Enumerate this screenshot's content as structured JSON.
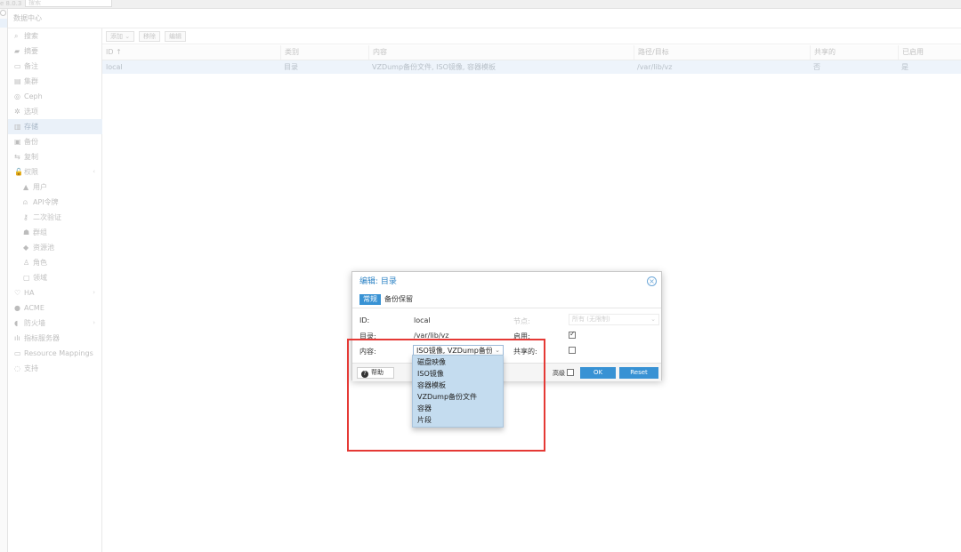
{
  "topbar": {
    "version": "e 8.0.3",
    "search_placeholder": "搜索"
  },
  "header": {
    "title": "数据中心"
  },
  "sidebar": {
    "items": [
      {
        "label": "搜索",
        "icon": "search-icon",
        "glyph": "⌕"
      },
      {
        "label": "摘要",
        "icon": "book-icon",
        "glyph": "▰"
      },
      {
        "label": "备注",
        "icon": "note-icon",
        "glyph": "▭"
      },
      {
        "label": "集群",
        "icon": "server-icon",
        "glyph": "▤"
      },
      {
        "label": "Ceph",
        "icon": "ceph-icon",
        "glyph": "◎"
      },
      {
        "label": "选项",
        "icon": "gear-icon",
        "glyph": "✲"
      },
      {
        "label": "存储",
        "icon": "database-icon",
        "glyph": "▥"
      },
      {
        "label": "备份",
        "icon": "floppy-icon",
        "glyph": "▣"
      },
      {
        "label": "复制",
        "icon": "retweet-icon",
        "glyph": "⇆"
      },
      {
        "label": "权限",
        "icon": "unlock-icon",
        "glyph": "🔓"
      },
      {
        "label": "用户",
        "icon": "user-icon",
        "glyph": "▲"
      },
      {
        "label": "API令牌",
        "icon": "user-outline-icon",
        "glyph": "⍝"
      },
      {
        "label": "二次验证",
        "icon": "key-icon",
        "glyph": "⚷"
      },
      {
        "label": "群组",
        "icon": "users-icon",
        "glyph": "☗"
      },
      {
        "label": "资源池",
        "icon": "tags-icon",
        "glyph": "◆"
      },
      {
        "label": "角色",
        "icon": "male-icon",
        "glyph": "♙"
      },
      {
        "label": "领域",
        "icon": "address-book-icon",
        "glyph": "▢"
      },
      {
        "label": "HA",
        "icon": "heartbeat-icon",
        "glyph": "♡"
      },
      {
        "label": "ACME",
        "icon": "certificate-icon",
        "glyph": "●"
      },
      {
        "label": "防火墙",
        "icon": "shield-icon",
        "glyph": "◖"
      },
      {
        "label": "指标服务器",
        "icon": "bar-chart-icon",
        "glyph": "ılı"
      },
      {
        "label": "Resource Mappings",
        "icon": "folder-icon",
        "glyph": "▭"
      },
      {
        "label": "支持",
        "icon": "comments-icon",
        "glyph": "◌"
      }
    ]
  },
  "toolbar": {
    "add": "添加",
    "remove": "移除",
    "edit": "编辑"
  },
  "grid": {
    "headers": [
      "ID ↑",
      "类别",
      "内容",
      "路径/目标",
      "共享的",
      "已启用"
    ],
    "rows": [
      [
        "local",
        "目录",
        "VZDump备份文件, ISO镜像, 容器模板",
        "/var/lib/vz",
        "否",
        "是"
      ]
    ]
  },
  "dialog": {
    "title": "编辑: 目录",
    "tabs": [
      "常规",
      "备份保留"
    ],
    "fields": {
      "id_label": "ID:",
      "id_value": "local",
      "node_label": "节点:",
      "node_value": "所有 (无限制)",
      "dir_label": "目录:",
      "dir_value": "/var/lib/vz",
      "enabled_label": "启用:",
      "content_label": "内容:",
      "content_value": "ISO镜像, VZDump备份文件",
      "shared_label": "共享的:"
    },
    "footer": {
      "help": "帮助",
      "advanced": "高级",
      "ok": "OK",
      "reset": "Reset"
    }
  },
  "dropdown": {
    "options": [
      "磁盘映像",
      "ISO镜像",
      "容器模板",
      "VZDump备份文件",
      "容器",
      "片段"
    ]
  },
  "colors": {
    "accent": "#3892d4",
    "selection": "#c4dcef",
    "annotation": "#e53935"
  }
}
